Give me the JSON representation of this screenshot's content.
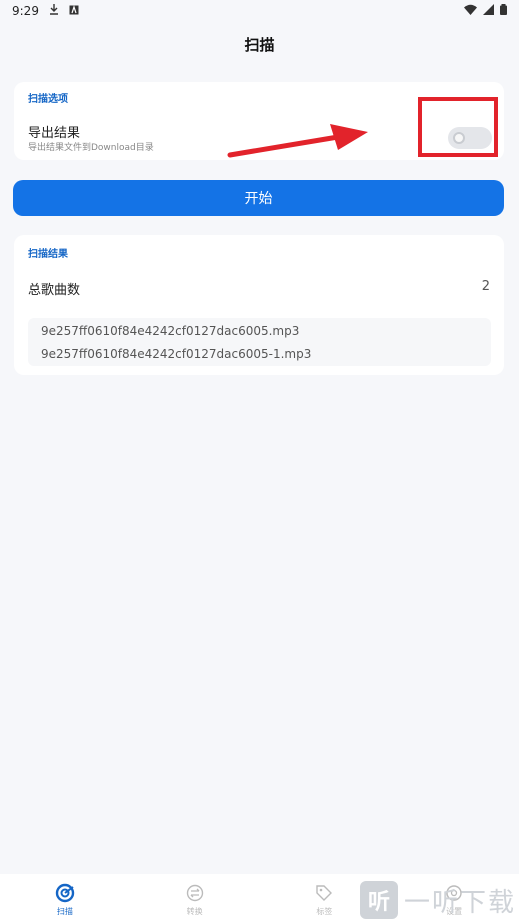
{
  "status": {
    "time": "9:29"
  },
  "header": {
    "title": "扫描"
  },
  "options": {
    "section_label": "扫描选项",
    "export_title": "导出结果",
    "export_subtitle": "导出结果文件到Download目录",
    "export_enabled": false
  },
  "start_button": {
    "label": "开始"
  },
  "results": {
    "section_label": "扫描结果",
    "total_label": "总歌曲数",
    "total_count": "2",
    "files": [
      "9e257ff0610f84e4242cf0127dac6005.mp3",
      "9e257ff0610f84e4242cf0127dac6005-1.mp3"
    ]
  },
  "bottom_nav": {
    "items": [
      {
        "label": "扫描",
        "icon": "scan-icon",
        "active": true
      },
      {
        "label": "转换",
        "icon": "convert-icon",
        "active": false
      },
      {
        "label": "标签",
        "icon": "tag-icon",
        "active": false
      },
      {
        "label": "设置",
        "icon": "settings-icon",
        "active": false
      }
    ]
  },
  "watermark": {
    "logo_char": "听",
    "text": "一听下载"
  },
  "colors": {
    "accent": "#1473e6",
    "highlight": "#e2232b",
    "background": "#f6f7fa"
  }
}
